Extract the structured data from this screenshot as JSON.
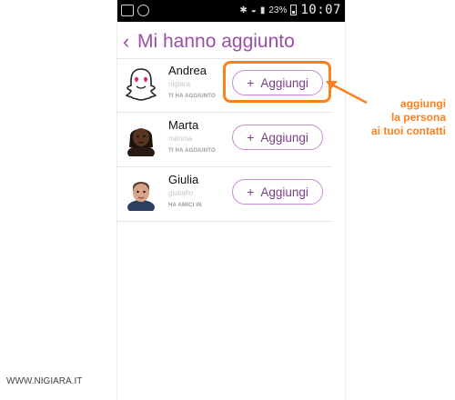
{
  "header": {
    "back_glyph": "‹",
    "title": "Mi hanno aggiunto"
  },
  "status_bar": {
    "battery_percent": "23%",
    "time": "10:07",
    "icons": [
      "image-icon",
      "whatsapp-icon",
      "bluetooth-icon",
      "wifi-icon",
      "signal-icon",
      "battery-icon"
    ]
  },
  "users": [
    {
      "name": "Andrea",
      "username": "nigiara",
      "status": "TI HA AGGIUNTO",
      "avatar": "snapchat-ghost-avatar",
      "button_label": "Aggiungi"
    },
    {
      "name": "Marta",
      "username": "mimma",
      "status": "TI HA AGGIUNTO",
      "avatar": "bitmoji-avatar",
      "button_label": "Aggiungi"
    },
    {
      "name": "Giulia",
      "username": "giuliafio",
      "status": "HA AMICI IN",
      "avatar": "bitmoji-avatar",
      "button_label": "Aggiungi"
    }
  ],
  "annotation": {
    "lines": [
      "aggiungi",
      "la persona",
      "ai tuoi contatti"
    ],
    "color": "#ff7f1a"
  },
  "watermark": "WWW.NIGIARA.IT",
  "colors": {
    "accent": "#9a4fa7",
    "button_border": "#c58cd0",
    "annotation": "#ff7f1a"
  }
}
